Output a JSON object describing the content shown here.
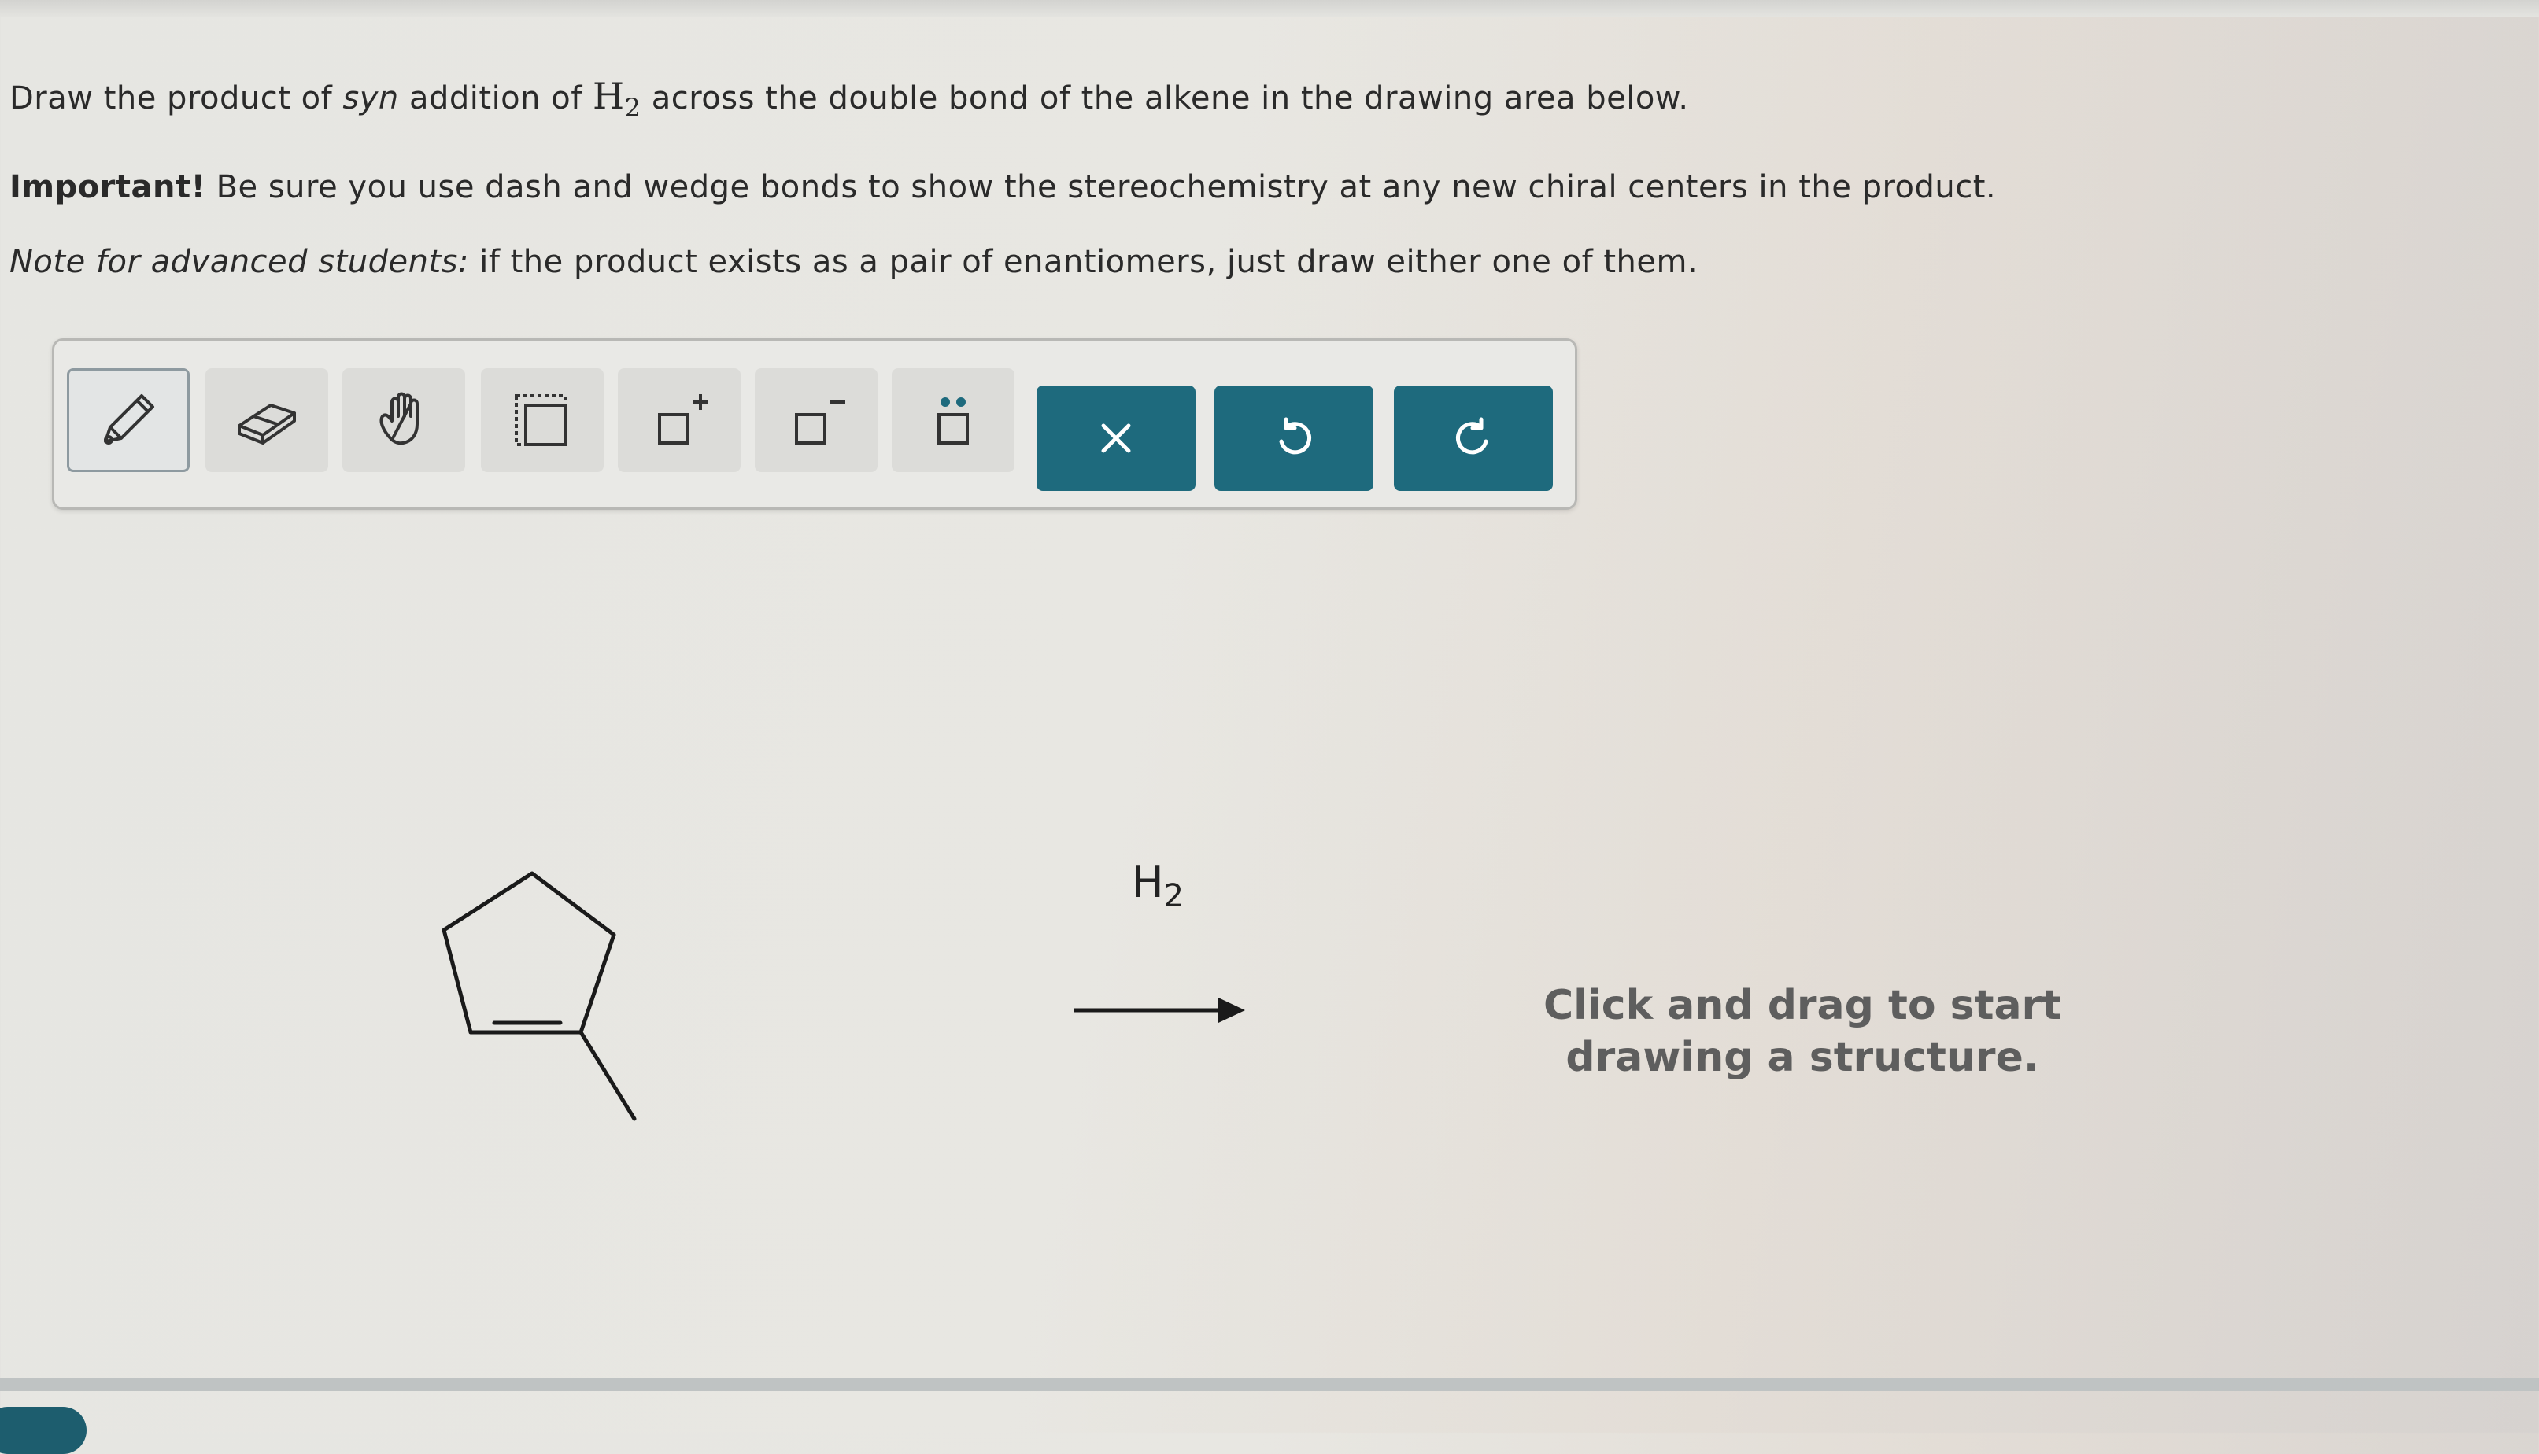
{
  "question": {
    "l1_a": "Draw the product of ",
    "l1_syn": "syn",
    "l1_b": " addition of ",
    "l1_formula_h": "H",
    "l1_formula_sub": "2",
    "l1_c": " across the double bond of the alkene in the drawing area below.",
    "important_label": "Important!",
    "important_text": " Be sure you use dash and wedge bonds to show the stereochemistry at any new chiral centers in the product.",
    "note_label": "Note for advanced students:",
    "note_text": " if the product exists as a pair of enantiomers, just draw either one of them."
  },
  "toolbar": {
    "tools": [
      {
        "name": "pencil-icon",
        "active": true
      },
      {
        "name": "eraser-icon",
        "active": false
      },
      {
        "name": "hand-icon",
        "active": false
      },
      {
        "name": "select-box-icon",
        "active": false
      },
      {
        "name": "add-positive-charge-icon",
        "active": false
      },
      {
        "name": "add-negative-charge-icon",
        "active": false
      },
      {
        "name": "lone-pair-icon",
        "active": false
      }
    ],
    "actions": [
      {
        "name": "clear-icon"
      },
      {
        "name": "undo-icon"
      },
      {
        "name": "redo-icon"
      }
    ],
    "accent_color": "#1e6a7d"
  },
  "reaction": {
    "reagent_h": "H",
    "reagent_sub": "2",
    "reactant": "1-methylcyclopentene skeletal structure"
  },
  "canvas": {
    "hint_line1": "Click and drag to start",
    "hint_line2": "drawing a structure."
  }
}
